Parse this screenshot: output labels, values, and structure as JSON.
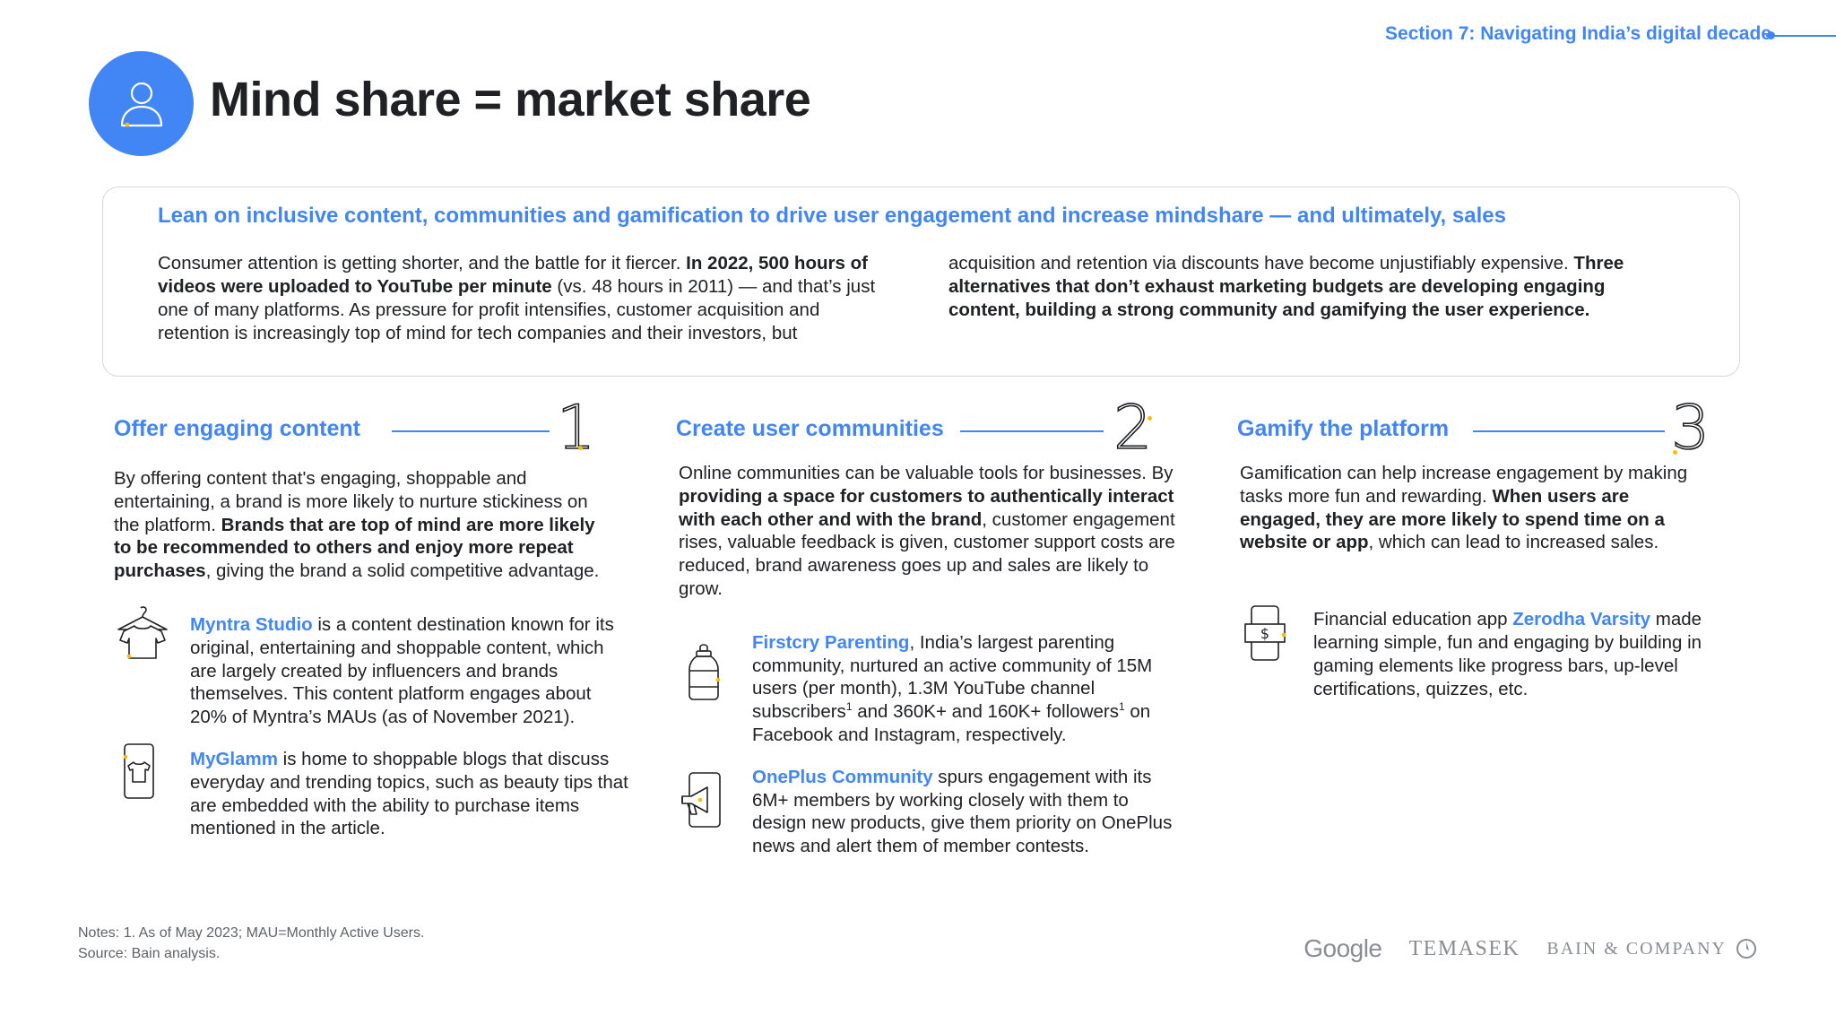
{
  "header": {
    "section_label": "Section 7: Navigating India’s digital decade",
    "title": "Mind share = market share"
  },
  "summary": {
    "heading": "Lean on inclusive content, communities and gamification to drive user engagement and increase mindshare — and ultimately, sales",
    "left": {
      "p1": "Consumer attention is getting shorter, and the battle for it fiercer. ",
      "b1": "In 2022, 500 hours of videos were uploaded to YouTube per minute",
      "p2": " (vs. 48 hours in 2011) — and that’s just one of many platforms. As pressure for profit intensifies, customer acquisition and retention is increasingly top of mind for tech companies and their investors, but"
    },
    "right": {
      "p1": "acquisition and retention via discounts have become unjustifiably expensive. ",
      "b1": "Three alternatives that don’t exhaust marketing budgets are developing engaging content, building a strong community and gamifying the user experience."
    }
  },
  "columns": [
    {
      "title": "Offer engaging content",
      "number": "1",
      "body_p1": "By offering content that's engaging, shoppable and entertaining, a brand is more likely to nurture stickiness on the platform. ",
      "body_b1": "Brands that are top of mind are more likely to be recommended to others and enjoy more repeat purchases",
      "body_p2": ", giving the brand a solid competitive advantage.",
      "examples": [
        {
          "icon": "tshirt-hanger-icon",
          "name": "Myntra Studio",
          "text": " is a content destination known for its original, entertaining and shoppable content, which are largely created by influencers and brands themselves. This content platform engages about 20% of Myntra’s MAUs (as of November 2021)."
        },
        {
          "icon": "phone-tshirt-icon",
          "name": "MyGlamm",
          "text": " is home to shoppable blogs that discuss everyday and trending topics, such as beauty tips that are embedded with the ability to purchase items mentioned in the article."
        }
      ]
    },
    {
      "title": "Create user communities",
      "number": "2",
      "body_p1": "Online communities can be valuable tools for businesses. By ",
      "body_b1": "providing a space for customers to authentically interact with each other and with the brand",
      "body_p2": ", customer engagement rises, valuable feedback is given, customer support costs are reduced, brand awareness goes up and sales are likely to grow.",
      "examples": [
        {
          "icon": "baby-bottle-icon",
          "name": "Firstcry Parenting",
          "text_a": ", India’s largest parenting community, nurtured an active community of 15M users (per month), 1.3M YouTube channel subscribers",
          "sup_a": "1",
          "text_b": " and 360K+ and 160K+ followers",
          "sup_b": "1",
          "text_c": " on Facebook and Instagram, respectively."
        },
        {
          "icon": "phone-megaphone-icon",
          "name": "OnePlus Community",
          "text": " spurs engagement with its 6M+ members by working closely with them to design new products, give them priority on OnePlus news and alert them of member contests."
        }
      ]
    },
    {
      "title": "Gamify the platform",
      "number": "3",
      "body_p1": "Gamification can help increase engagement by making tasks more fun and rewarding. ",
      "body_b1": "When users are engaged, they are more likely to spend time on a website or app",
      "body_p2": ", which can lead to increased sales.",
      "examples": [
        {
          "icon": "phone-dollar-icon",
          "prefix": "Financial education app ",
          "name": "Zerodha Varsity",
          "text": " made learning simple, fun and engaging by building in gaming elements like progress bars, up-level certifications, quizzes, etc."
        }
      ]
    }
  ],
  "footer": {
    "notes": "Notes: 1. As of May 2023; MAU=Monthly Active Users.",
    "source": "Source: Bain analysis.",
    "logos": {
      "google": "Google",
      "temasek": "TEMASEK",
      "bain": "BAIN & COMPANY"
    }
  },
  "colors": {
    "accent": "#4285f4",
    "highlight": "#fbbc04",
    "text": "#202124"
  }
}
